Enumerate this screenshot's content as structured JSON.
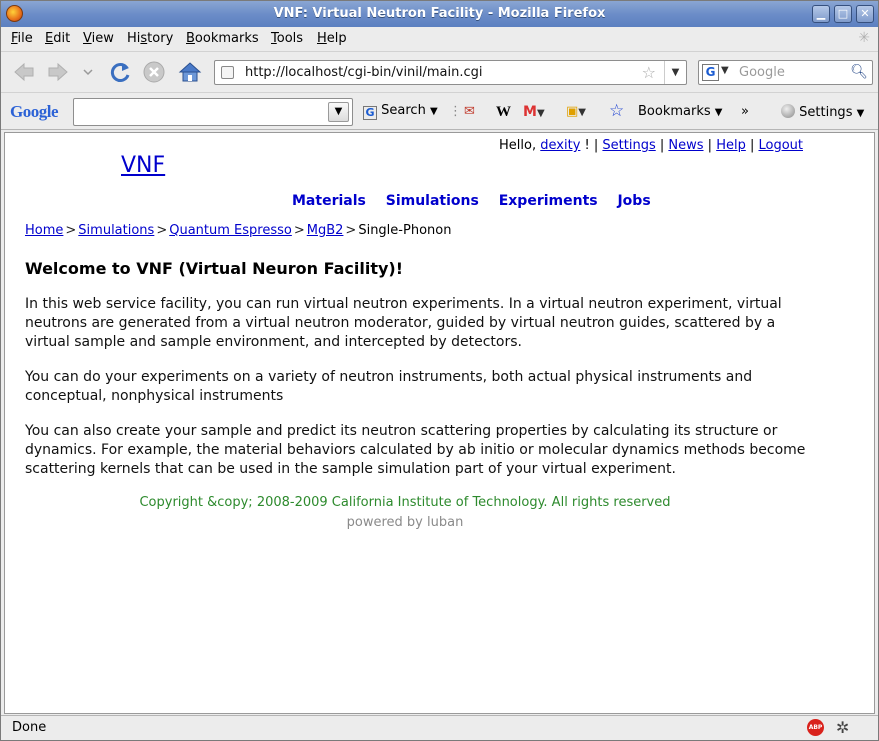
{
  "window": {
    "title": "VNF: Virtual Neutron Facility - Mozilla Firefox",
    "controls": {
      "minimize": "▁",
      "maximize": "□",
      "close": "✕"
    }
  },
  "menubar": {
    "items": [
      {
        "label": "File",
        "accel": "F",
        "rest": "ile"
      },
      {
        "label": "Edit",
        "accel": "E",
        "rest": "dit"
      },
      {
        "label": "View",
        "accel": "V",
        "rest": "iew"
      },
      {
        "label": "History",
        "accel": "s",
        "pre": "Hi",
        "rest": "tory"
      },
      {
        "label": "Bookmarks",
        "accel": "B",
        "rest": "ookmarks"
      },
      {
        "label": "Tools",
        "accel": "T",
        "rest": "ools"
      },
      {
        "label": "Help",
        "accel": "H",
        "rest": "elp"
      }
    ]
  },
  "navbar": {
    "url": "http://localhost/cgi-bin/vinil/main.cgi",
    "search_placeholder": "Google",
    "search_engine_glyph": "G"
  },
  "google_toolbar": {
    "logo": "Google",
    "search_label": "Search",
    "bookmarks_label": "Bookmarks",
    "settings_label": "Settings",
    "more_glyph": "»",
    "wiki_glyph": "W",
    "gmail_glyph": "M"
  },
  "page": {
    "user_greeting": "Hello,",
    "username": "dexity",
    "user_sep": "!",
    "user_links": [
      "Settings",
      "News",
      "Help",
      "Logout"
    ],
    "logo": "VNF",
    "nav": [
      "Materials",
      "Simulations",
      "Experiments",
      "Jobs"
    ],
    "breadcrumbs": [
      "Home",
      "Simulations",
      "Quantum Espresso",
      "MgB2"
    ],
    "breadcrumb_current": "Single-Phonon",
    "heading": "Welcome to VNF (Virtual Neuron Facility)!",
    "paragraphs": [
      "In this web service facility, you can run virtual neutron experiments. In a virtual neutron experiment, virtual neutrons are generated from a virtual neutron moderator, guided by virtual neutron guides, scattered by a virtual sample and sample environment, and intercepted by detectors.",
      "You can do your experiments on a variety of neutron instruments, both actual physical instruments and conceptual, nonphysical instruments",
      "You can also create your sample and predict its neutron scattering properties by calculating its structure or dynamics. For example, the material behaviors calculated by ab initio or molecular dynamics methods become scattering kernels that can be used in the sample simulation part of your virtual experiment."
    ],
    "copyright": "Copyright &copy; 2008-2009 California Institute of Technology. All rights reserved",
    "powered_by": "powered by luban"
  },
  "statusbar": {
    "status": "Done",
    "adblock": "ABP"
  },
  "colors": {
    "link": "#0000cc",
    "copyright": "#2d8a2d",
    "titlebar": "#6c8dc8"
  }
}
